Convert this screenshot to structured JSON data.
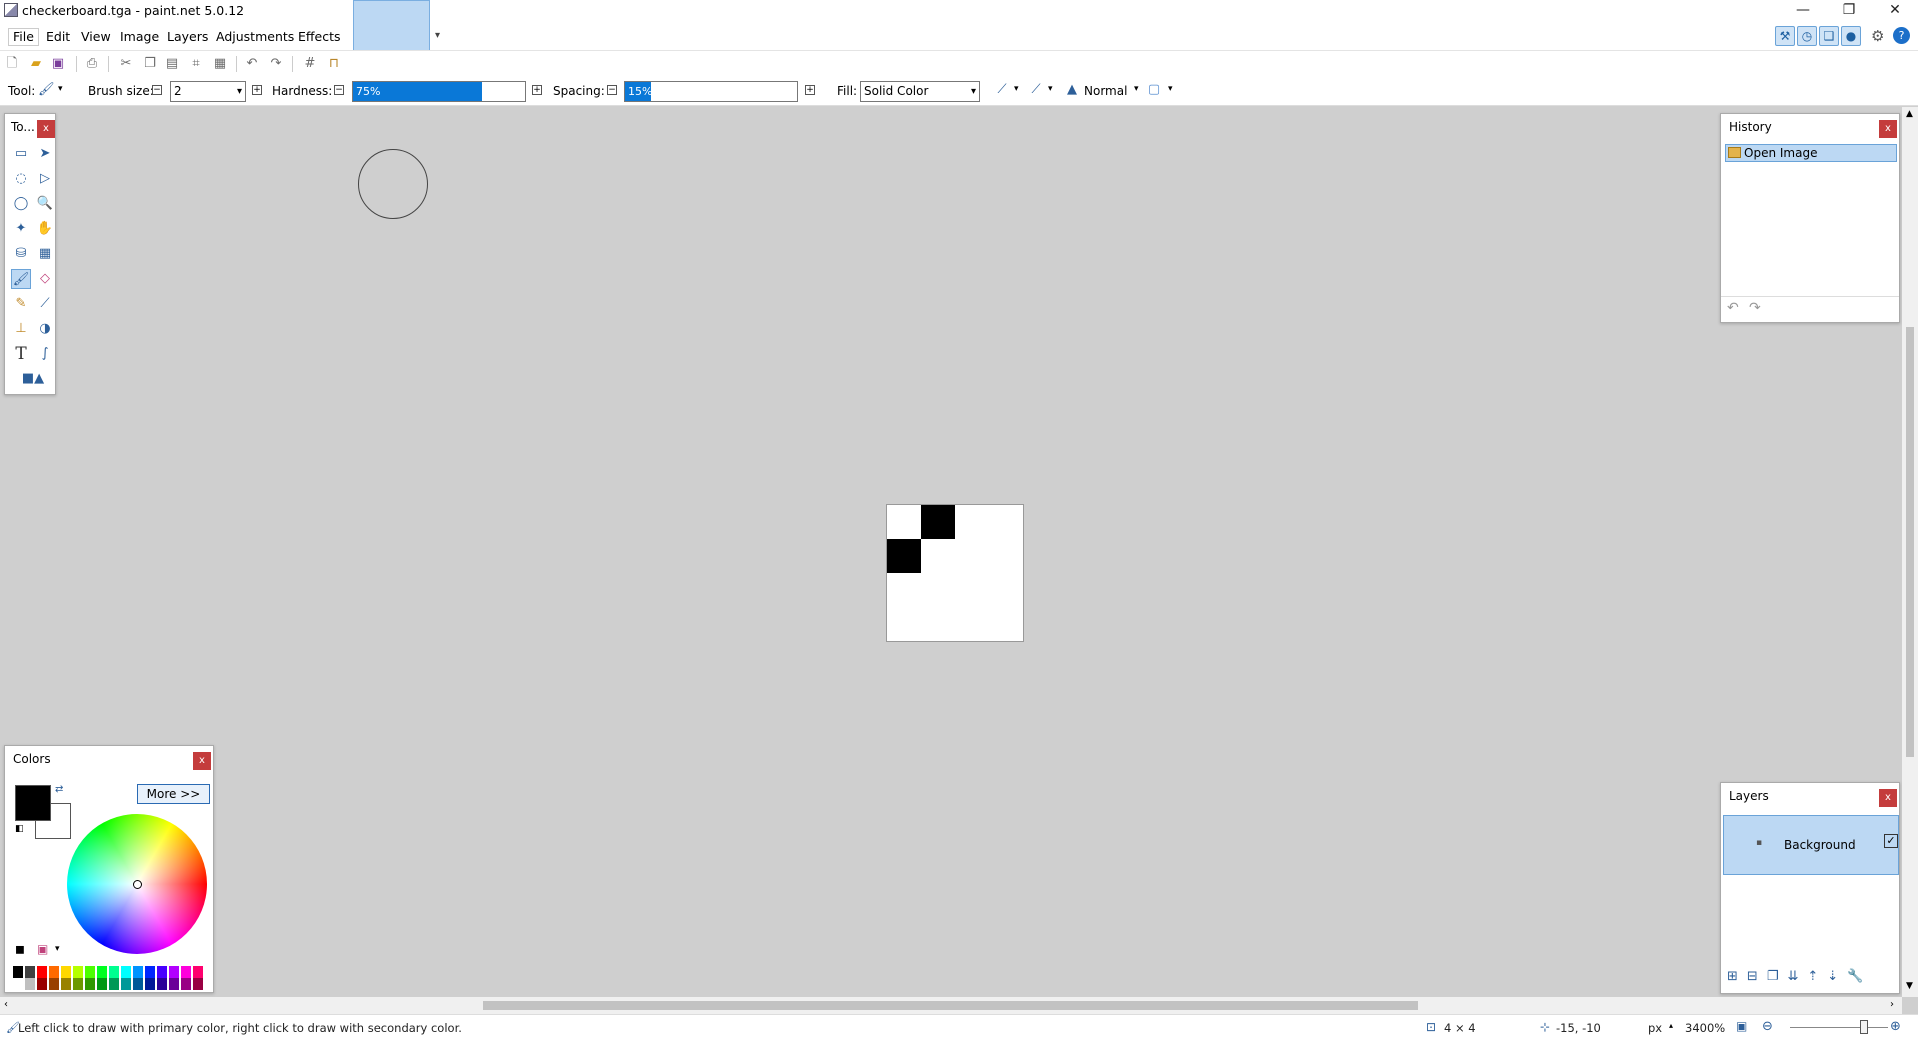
{
  "window": {
    "title": "checkerboard.tga - paint.net 5.0.12",
    "minimize_glyph": "—",
    "restore_glyph": "❐",
    "close_glyph": "✕"
  },
  "menu": {
    "items": [
      "File",
      "Edit",
      "View",
      "Image",
      "Layers",
      "Adjustments",
      "Effects"
    ]
  },
  "options": {
    "tool_label": "Tool:",
    "brush_size_label": "Brush size:",
    "brush_size_value": "2",
    "hardness_label": "Hardness:",
    "hardness_value": "75%",
    "hardness_fraction": 0.75,
    "spacing_label": "Spacing:",
    "spacing_value": "15%",
    "spacing_fraction": 0.15,
    "fill_label": "Fill:",
    "fill_value": "Solid Color",
    "blend_mode": "Normal"
  },
  "tools_panel": {
    "title": "To...",
    "close": "x",
    "active_tool": "paintbrush"
  },
  "history_panel": {
    "title": "History",
    "close": "x",
    "items": [
      "Open Image"
    ]
  },
  "layers_panel": {
    "title": "Layers",
    "close": "x",
    "layers": [
      {
        "name": "Background",
        "visible": true
      }
    ]
  },
  "colors_panel": {
    "title": "Colors",
    "close": "x",
    "more_label": "More >>",
    "primary": "#000000",
    "secondary": "#ffffff",
    "palette": [
      "#000000",
      "#404040",
      "#ff0000",
      "#ff6a00",
      "#ffd800",
      "#b6ff00",
      "#4cff00",
      "#00ff21",
      "#00ff90",
      "#00ffff",
      "#0094ff",
      "#0026ff",
      "#4800ff",
      "#b200ff",
      "#ff00dc",
      "#ff006e"
    ]
  },
  "canvas": {
    "image_width": 4,
    "image_height": 4
  },
  "status": {
    "hint": "Left click to draw with primary color, right click to draw with secondary color.",
    "image_size": "4 × 4",
    "cursor_position": "-15, -10",
    "units": "px",
    "zoom": "3400%"
  }
}
